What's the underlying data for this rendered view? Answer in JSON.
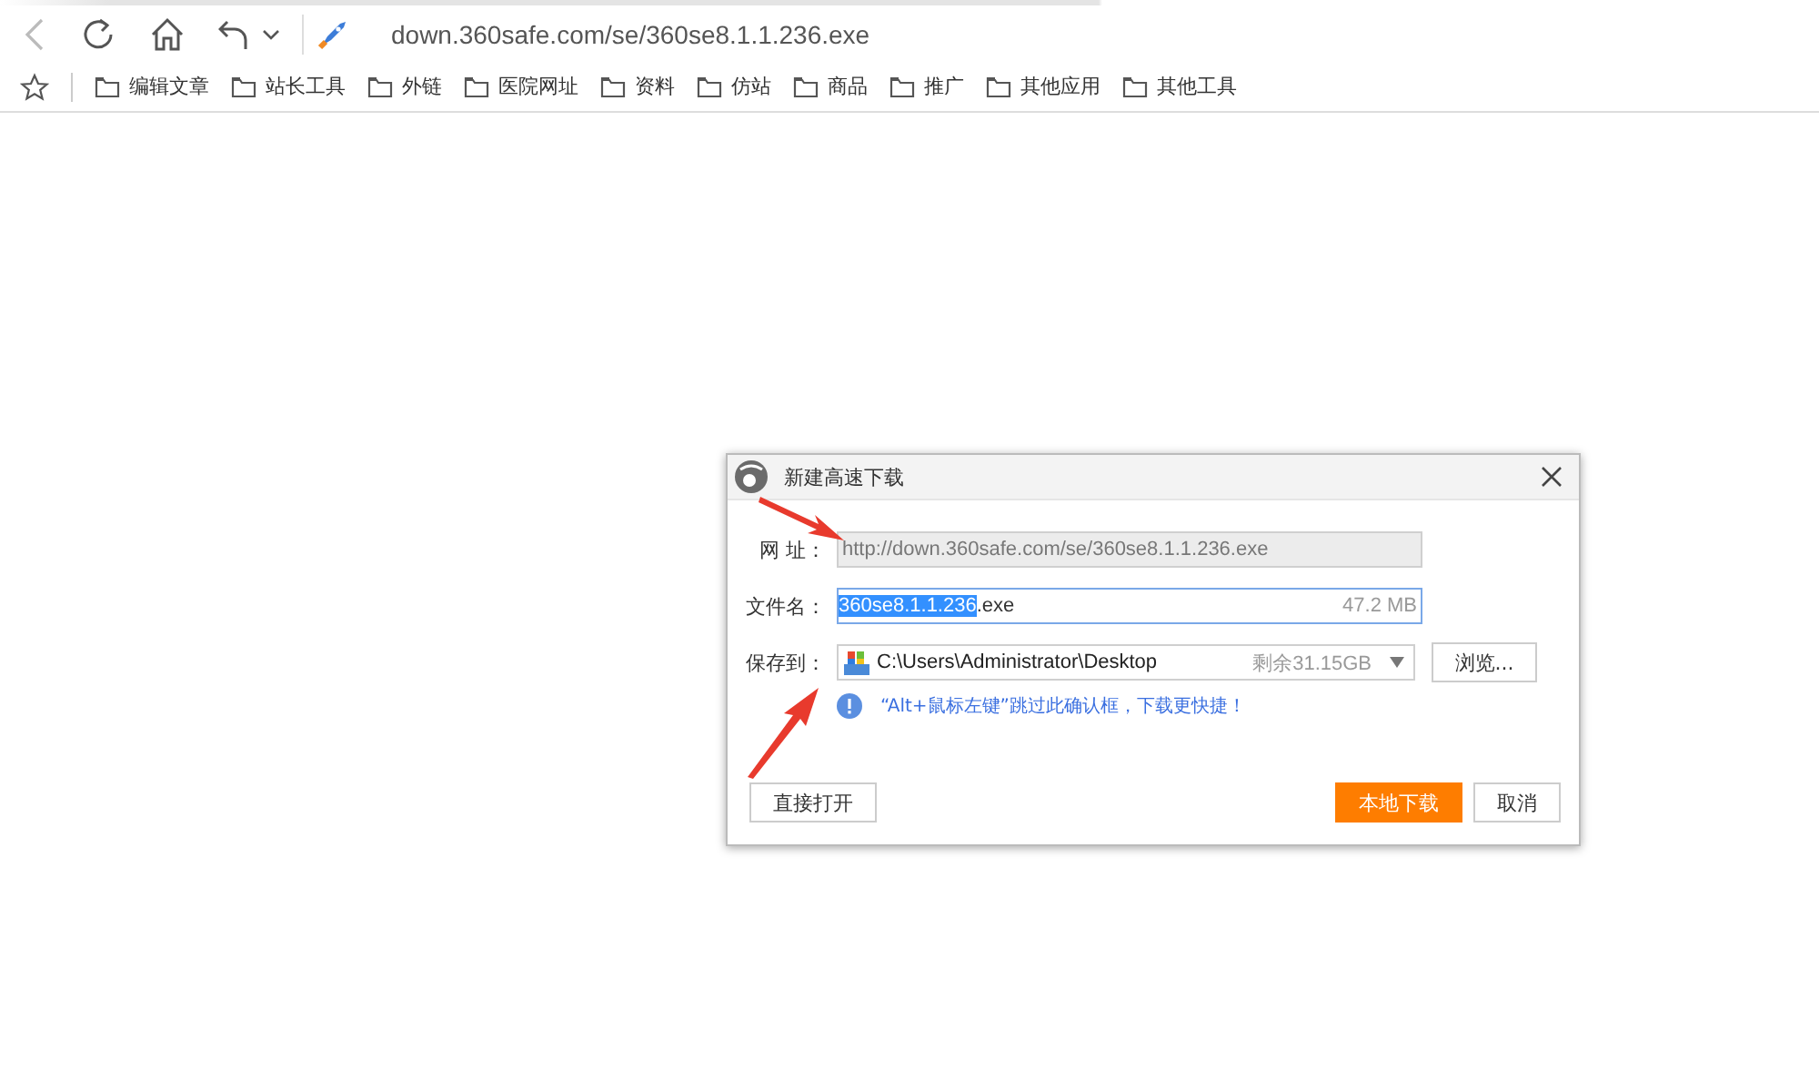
{
  "toolbar": {
    "address": "down.360safe.com/se/360se8.1.1.236.exe"
  },
  "bookmarks": [
    {
      "label": "编辑文章"
    },
    {
      "label": "站长工具"
    },
    {
      "label": "外链"
    },
    {
      "label": "医院网址"
    },
    {
      "label": "资料"
    },
    {
      "label": "仿站"
    },
    {
      "label": "商品"
    },
    {
      "label": "推广"
    },
    {
      "label": "其他应用"
    },
    {
      "label": "其他工具"
    }
  ],
  "dialog": {
    "title": "新建高速下载",
    "url": {
      "label": "网 址：",
      "value": "http://down.360safe.com/se/360se8.1.1.236.exe",
      "disabled": true
    },
    "filename": {
      "label": "文件名：",
      "selected_part": "360se8.1.1.236",
      "rest": ".exe",
      "size": "47.2 MB"
    },
    "save_to": {
      "label": "保存到：",
      "path": "C:\\Users\\Administrator\\Desktop",
      "free": "剩余31.15GB",
      "browse": "浏览..."
    },
    "hint": "“Alt+鼠标左键”跳过此确认框，下载更快捷！",
    "buttons": [
      {
        "label": "直接打开",
        "kind": "secondary"
      },
      {
        "label": "本地下载",
        "kind": "primary"
      },
      {
        "label": "取消",
        "kind": "secondary"
      }
    ]
  }
}
